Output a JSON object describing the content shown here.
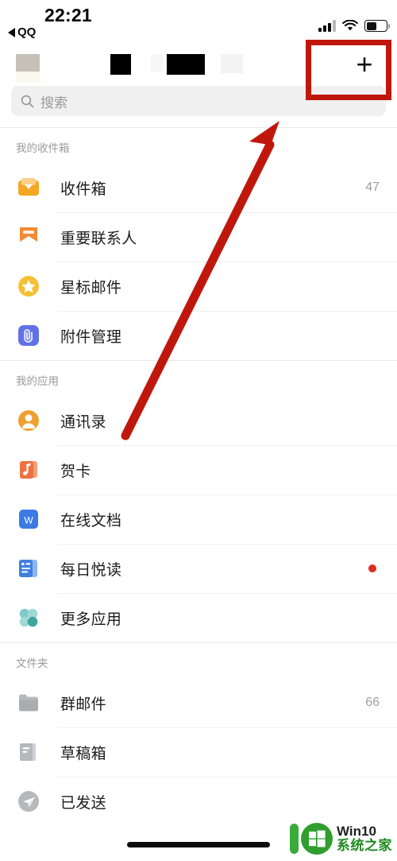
{
  "status_bar": {
    "time": "22:21",
    "back_label": "QQ",
    "signal_icon": "signal-bars-icon",
    "wifi_icon": "wifi-icon",
    "battery_icon": "battery-icon",
    "battery_level_percent": 48
  },
  "header": {
    "add_button_label": "+",
    "add_button_icon": "plus-icon",
    "account_name_redacted": true
  },
  "search": {
    "placeholder": "搜索",
    "icon": "search-icon"
  },
  "sections": [
    {
      "title": "我的收件箱",
      "items": [
        {
          "label": "收件箱",
          "icon": "inbox-tray-icon",
          "icon_color": "#f5a623",
          "count": "47",
          "dot": false
        },
        {
          "label": "重要联系人",
          "icon": "bookmark-flag-icon",
          "icon_color": "#f08a35",
          "count": "",
          "dot": false
        },
        {
          "label": "星标邮件",
          "icon": "star-circle-icon",
          "icon_color": "#f5c033",
          "count": "",
          "dot": false
        },
        {
          "label": "附件管理",
          "icon": "attachment-manager-icon",
          "icon_color": "#6071e8",
          "count": "",
          "dot": false
        }
      ]
    },
    {
      "title": "我的应用",
      "items": [
        {
          "label": "通讯录",
          "icon": "contacts-person-icon",
          "icon_color": "#f0a02e",
          "count": "",
          "dot": false
        },
        {
          "label": "贺卡",
          "icon": "greeting-card-music-icon",
          "icon_color": "#ef7141",
          "count": "",
          "dot": false
        },
        {
          "label": "在线文档",
          "icon": "online-document-w-icon",
          "icon_color": "#3c7ae4",
          "count": "",
          "dot": false
        },
        {
          "label": "每日悦读",
          "icon": "daily-reading-icon",
          "icon_color": "#3f7fe0",
          "count": "",
          "dot": true
        },
        {
          "label": "更多应用",
          "icon": "more-apps-grid-icon",
          "icon_color": "#54b3ae",
          "count": "",
          "dot": false
        }
      ]
    },
    {
      "title": "文件夹",
      "items": [
        {
          "label": "群邮件",
          "icon": "folder-icon",
          "icon_color": "#b6b8bb",
          "count": "66",
          "dot": false
        },
        {
          "label": "草稿箱",
          "icon": "draft-document-icon",
          "icon_color": "#b6b8bb",
          "count": "",
          "dot": false
        },
        {
          "label": "已发送",
          "icon": "sent-paper-plane-icon",
          "icon_color": "#b6b8bb",
          "count": "",
          "dot": false
        }
      ]
    }
  ],
  "annotations": {
    "highlight_box_target": "plus-button",
    "arrow_color": "#c0170d",
    "box_color": "#c0170d"
  },
  "watermark": {
    "line1": "Win10",
    "line2": "系统之家",
    "logo_icon": "windows-logo-icon"
  }
}
